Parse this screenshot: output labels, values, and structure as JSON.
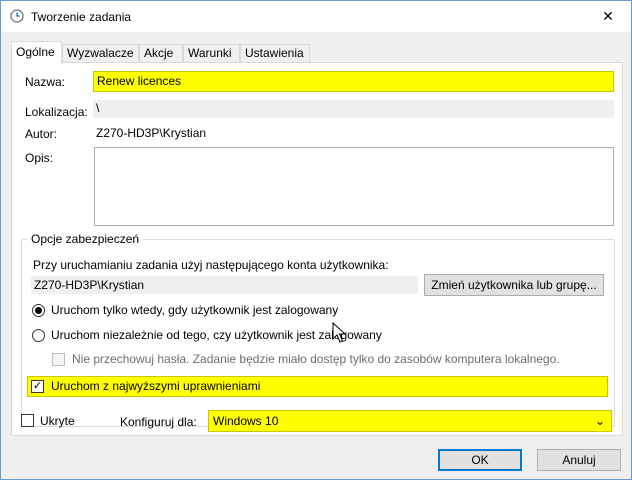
{
  "window": {
    "title": "Tworzenie zadania",
    "title_icon": "clock-icon",
    "close_icon": "close-icon",
    "close_glyph": "✕"
  },
  "tabs": [
    {
      "label": "Ogólne",
      "active": true
    },
    {
      "label": "Wyzwalacze"
    },
    {
      "label": "Akcje"
    },
    {
      "label": "Warunki"
    },
    {
      "label": "Ustawienia"
    }
  ],
  "general": {
    "name_label": "Nazwa:",
    "name_value": "Renew licences",
    "location_label": "Lokalizacja:",
    "location_value": "\\",
    "author_label": "Autor:",
    "author_value": "Z270-HD3P\\Krystian",
    "description_label": "Opis:",
    "description_value": ""
  },
  "security": {
    "group_title": "Opcje zabezpieczeń",
    "account_prompt": "Przy uruchamianiu zadania użyj następującego konta użytkownika:",
    "account_value": "Z270-HD3P\\Krystian",
    "change_user_button": "Zmień użytkownika lub grupę...",
    "radio_logged_on": "Uruchom tylko wtedy, gdy użytkownik jest zalogowany",
    "radio_logged_on_checked": true,
    "radio_regardless": "Uruchom niezależnie od tego, czy użytkownik jest zalogowany",
    "radio_regardless_checked": false,
    "no_store_password": "Nie przechowuj hasła. Zadanie będzie miało dostęp tylko do zasobów komputera lokalnego.",
    "no_store_password_checked": false,
    "highest_privileges": "Uruchom z najwyższymi uprawnieniami",
    "highest_privileges_checked": true,
    "check_glyph": "✓"
  },
  "footer": {
    "hidden_label": "Ukryte",
    "hidden_checked": false,
    "configure_label": "Konfiguruj dla:",
    "configure_value": "Windows 10",
    "chevron_glyph": "⌄",
    "ok_button": "OK",
    "cancel_button": "Anuluj"
  },
  "colors": {
    "highlight": "#ffff00",
    "accent": "#0078d7"
  }
}
